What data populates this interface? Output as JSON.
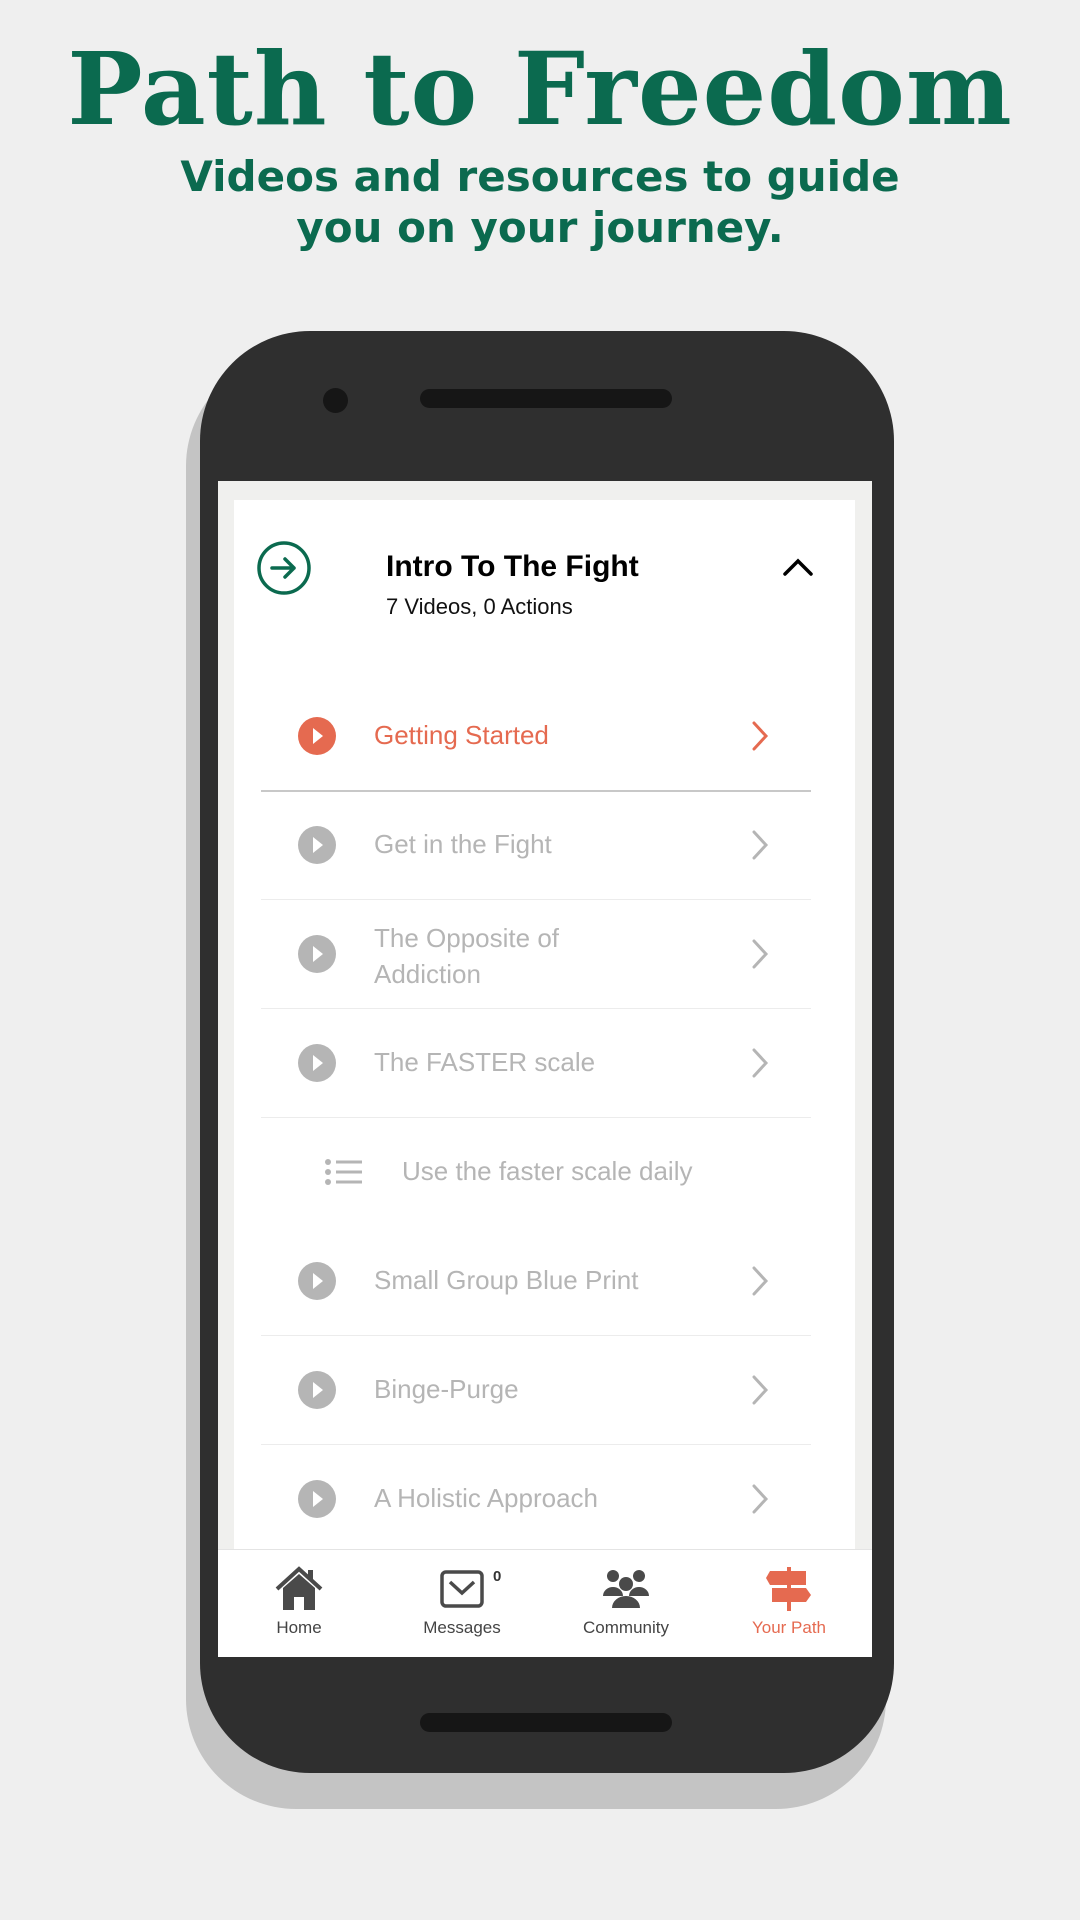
{
  "hero": {
    "title": "Path to Freedom",
    "subtitle_line1": "Videos and resources to guide",
    "subtitle_line2": "you on your journey."
  },
  "colors": {
    "brand_green": "#0b6a4f",
    "accent": "#e56a50",
    "muted": "#b5b5b5"
  },
  "section": {
    "title": "Intro To The Fight",
    "subtitle": "7 Videos, 0 Actions",
    "icon": "arrow-right-circle-icon",
    "toggle_icon": "chevron-up-icon"
  },
  "items": [
    {
      "type": "video",
      "label": "Getting Started",
      "active": true
    },
    {
      "type": "video",
      "label": "Get in the Fight",
      "active": false
    },
    {
      "type": "video",
      "label": "The Opposite of Addiction",
      "label_line1": "The Opposite of",
      "label_line2": "Addiction",
      "active": false
    },
    {
      "type": "video",
      "label": "The FASTER scale",
      "active": false
    },
    {
      "type": "action",
      "label": "Use the faster scale daily",
      "active": false
    },
    {
      "type": "video",
      "label": "Small Group Blue Print",
      "active": false
    },
    {
      "type": "video",
      "label": "Binge-Purge",
      "active": false
    },
    {
      "type": "video",
      "label": "A Holistic Approach",
      "active": false
    }
  ],
  "tabs": [
    {
      "label": "Home",
      "icon": "home-icon",
      "active": false
    },
    {
      "label": "Messages",
      "icon": "envelope-icon",
      "badge": "0",
      "active": false
    },
    {
      "label": "Community",
      "icon": "people-icon",
      "active": false
    },
    {
      "label": "Your Path",
      "icon": "signpost-icon",
      "active": true
    }
  ]
}
